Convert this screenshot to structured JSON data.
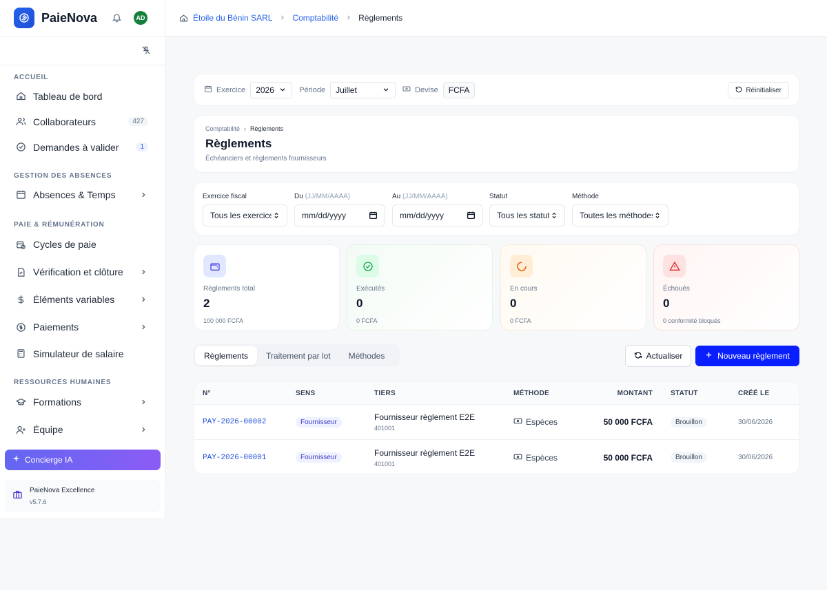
{
  "app": {
    "name": "PaieNova",
    "avatar_initials": "AD"
  },
  "breadcrumb": {
    "home": "Étoile du Bénin SARL",
    "section": "Comptabilité",
    "current": "Règlements"
  },
  "sidebar": {
    "sections": [
      {
        "title": "ACCUEIL",
        "items": [
          {
            "label": "Tableau de bord",
            "icon": "home-icon"
          },
          {
            "label": "Collaborateurs",
            "icon": "users-icon",
            "badge": "427"
          },
          {
            "label": "Demandes à valider",
            "icon": "check-circle-icon",
            "badge": "1"
          }
        ]
      },
      {
        "title": "GESTION DES ABSENCES",
        "items": [
          {
            "label": "Absences & Temps",
            "icon": "calendar-icon",
            "chevron": true
          }
        ]
      },
      {
        "title": "PAIE & RÉMUNÉRATION",
        "items": [
          {
            "label": "Cycles de paie",
            "icon": "calendar-clock-icon"
          },
          {
            "label": "Vérification et clôture",
            "icon": "file-check-icon",
            "chevron": true
          },
          {
            "label": "Éléments variables",
            "icon": "dollar-icon",
            "chevron": true
          },
          {
            "label": "Paiements",
            "icon": "coin-icon",
            "chevron": true
          },
          {
            "label": "Simulateur de salaire",
            "icon": "calculator-icon"
          }
        ]
      },
      {
        "title": "RESSOURCES HUMAINES",
        "items": [
          {
            "label": "Formations",
            "icon": "graduation-cap-icon",
            "chevron": true
          },
          {
            "label": "Équipe",
            "icon": "user-plus-icon",
            "chevron": true
          }
        ]
      }
    ],
    "concierge": "Concierge IA",
    "excellence": {
      "title": "PaieNova Excellence",
      "version": "v5.7.6"
    }
  },
  "toolbar": {
    "exercice_label": "Exercice",
    "exercice_value": "2026",
    "periode_label": "Période",
    "periode_value": "Juillet",
    "devise_label": "Devise",
    "devise_value": "FCFA",
    "reset_label": "Réinitialiser"
  },
  "page": {
    "mini_breadcrumb": [
      "Comptabilité",
      "Règlements"
    ],
    "title": "Règlements",
    "subtitle": "Échéanciers et règlements fournisseurs"
  },
  "filters": {
    "exercice": {
      "label": "Exercice fiscal",
      "value": "Tous les exercices"
    },
    "du": {
      "label": "Du",
      "hint": "(JJ/MM/AAAA)",
      "value": "mm/dd/yyyy"
    },
    "au": {
      "label": "Au",
      "hint": "(JJ/MM/AAAA)",
      "value": "mm/dd/yyyy"
    },
    "statut": {
      "label": "Statut",
      "value": "Tous les statuts"
    },
    "methode": {
      "label": "Méthode",
      "value": "Toutes les méthodes"
    }
  },
  "stats": [
    {
      "label": "Règlements total",
      "value": "2",
      "sub": "100 000 FCFA",
      "icon": "wallet-icon",
      "color": "#4f46e5"
    },
    {
      "label": "Exécutés",
      "value": "0",
      "sub": "0 FCFA",
      "icon": "check-circle-icon",
      "color": "#16a34a"
    },
    {
      "label": "En cours",
      "value": "0",
      "sub": "0 FCFA",
      "icon": "loader-icon",
      "color": "#ea580c"
    },
    {
      "label": "Échoués",
      "value": "0",
      "sub": "0 conformité bloqués",
      "icon": "warning-icon",
      "color": "#dc2626"
    }
  ],
  "tabs": [
    "Règlements",
    "Traitement par lot",
    "Méthodes"
  ],
  "actions": {
    "refresh": "Actualiser",
    "new": "Nouveau règlement"
  },
  "table": {
    "columns": [
      "N°",
      "SENS",
      "TIERS",
      "MÉTHODE",
      "MONTANT",
      "STATUT",
      "CRÉÉ LE"
    ],
    "rows": [
      {
        "num": "PAY-2026-00002",
        "sens": "Fournisseur",
        "tiers": "Fournisseur règlement E2E",
        "code": "401001",
        "methode": "Espèces",
        "montant": "50 000 FCFA",
        "statut": "Brouillon",
        "cree": "30/06/2026"
      },
      {
        "num": "PAY-2026-00001",
        "sens": "Fournisseur",
        "tiers": "Fournisseur règlement E2E",
        "code": "401001",
        "methode": "Espèces",
        "montant": "50 000 FCFA",
        "statut": "Brouillon",
        "cree": "30/06/2026"
      }
    ]
  }
}
